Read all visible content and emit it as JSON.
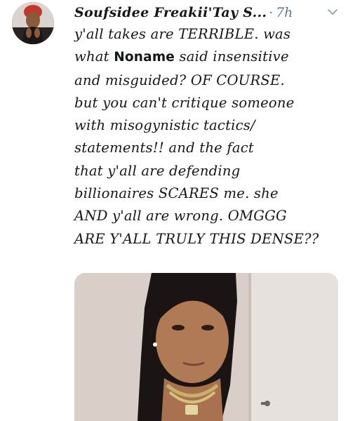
{
  "tweet": {
    "display_name": "Soufsidee Freakii'Tay S...",
    "separator": "·",
    "timestamp": "7h",
    "lines": [
      "y'all takes are TERRIBLE. was",
      "what ",
      "and misguided? OF COURSE.",
      "but you can't critique someone",
      "with misogynistic tactics/",
      "statements!! and the fact",
      "that y'all are defending",
      "billionaires SCARES me. she",
      "AND y'all are wrong. OMGGG",
      "ARE Y'ALL TRULY THIS DENSE??"
    ],
    "line2_mention": "Noname",
    "line2_rest": " said insensitive"
  },
  "icons": {
    "more": "chevron-down-icon"
  },
  "colors": {
    "text": "#14171a",
    "muted": "#657786"
  }
}
